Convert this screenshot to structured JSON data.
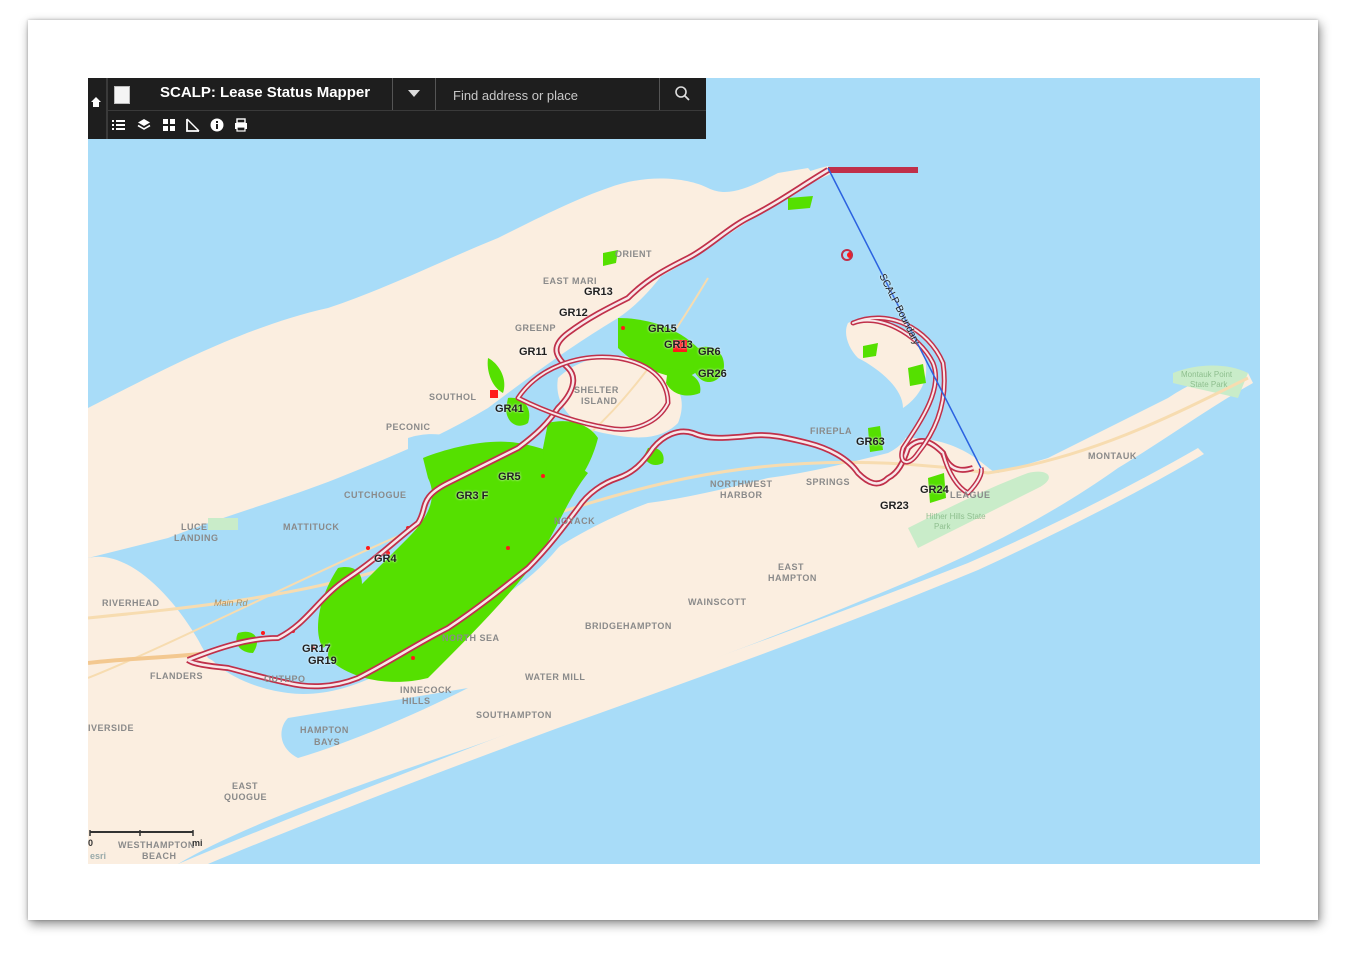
{
  "toolbar": {
    "title": "SCALP: Lease Status Mapper",
    "search_placeholder": "Find address or place"
  },
  "icons": {
    "home": "home-icon",
    "logo": "broken-image-icon",
    "dropdown": "chevron-down-icon",
    "search": "search-icon",
    "tools": [
      "legend-list-icon",
      "layers-icon",
      "basemap-grid-icon",
      "measure-icon",
      "info-icon",
      "print-icon"
    ]
  },
  "colors": {
    "water": "#a8dcf8",
    "land": "#fbeee0",
    "lease_green": "#55e000",
    "lease_red": "#ff1a1a",
    "boundary_outline": "#c0304a",
    "boundary_line": "#2b62e0",
    "toolbar_bg": "#1e1e1e"
  },
  "map": {
    "places": {
      "orient": "ORIENT",
      "east_marion": "EAST MARI",
      "greenport": "GREENP",
      "southold": "SOUTHOL",
      "shelter_island_1": "SHELTER",
      "shelter_island_2": "ISLAND",
      "peconic": "PECONIC",
      "cutchogue": "CUTCHOGUE",
      "mattituck": "MATTITUCK",
      "luce_landing_1": "LUCE",
      "luce_landing_2": "LANDING",
      "riverhead": "RIVERHEAD",
      "main_rd": "Main Rd",
      "flanders": "FLANDERS",
      "riverside": "IVERSIDE",
      "southport": "OUTHPO",
      "north_sea": "NORTH SEA",
      "noyack": "NOYACK",
      "northwest_harbor_1": "NORTHWEST",
      "northwest_harbor_2": "HARBOR",
      "springs": "SPRINGS",
      "fireplace": "FIREPLA",
      "east_hampton_1": "EAST",
      "east_hampton_2": "HAMPTON",
      "wainscott": "WAINSCOTT",
      "bridgehampton": "BRIDGEHAMPTON",
      "water_mill": "WATER MILL",
      "shinnecock_hills_1": "INNECOCK",
      "shinnecock_hills_2": "HILLS",
      "southampton": "SOUTHAMPTON",
      "hampton_bays_1": "HAMPTON",
      "hampton_bays_2": "BAYS",
      "east_quogue_1": "EAST",
      "east_quogue_2": "QUOGUE",
      "westhampton_1": "WESTHAMPTON",
      "westhampton_2": "BEACH",
      "montauk": "MONTAUK",
      "amagansett": "LEAGUE",
      "montauk_point_1": "Montauk Point",
      "montauk_point_2": "State Park",
      "hither_hills_1": "Hither Hills State",
      "hither_hills_2": "Park"
    },
    "leases": {
      "gr13a": "GR13",
      "gr12": "GR12",
      "gr15": "GR15",
      "gr13b": "GR13",
      "gr6": "GR6",
      "gr26": "GR26",
      "gr11": "GR11",
      "gr41": "GR41",
      "gr5": "GR5",
      "gr3f": "GR3 F",
      "gr4": "GR4",
      "gr17": "GR17",
      "gr19": "GR19",
      "gr63": "GR63",
      "gr24": "GR24",
      "gr23": "GR23"
    },
    "boundary_label": "SCALP Boundary",
    "scale_unit": "mi",
    "scale_zero": "0",
    "attribution": "esri"
  }
}
